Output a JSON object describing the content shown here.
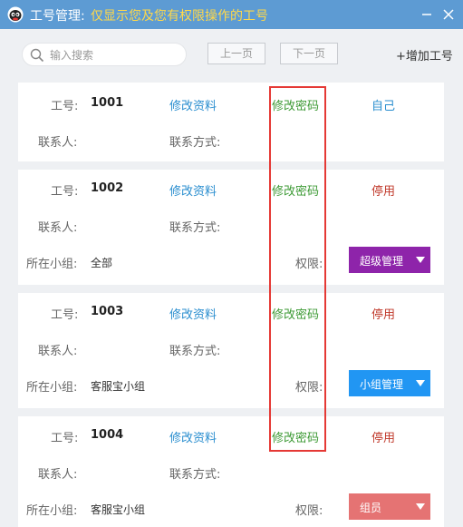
{
  "window": {
    "title": "工号管理:",
    "subtitle": "仅显示您及您有权限操作的工号",
    "minimize_icon": "minimize-icon",
    "close_icon": "close-icon"
  },
  "toolbar": {
    "search_placeholder": "输入搜索",
    "prev_label": "上一页",
    "next_label": "下一页",
    "add_label": "+增加工号"
  },
  "labels": {
    "id": "工号:",
    "contact_person": "联系人:",
    "contact_method": "联系方式:",
    "group": "所在小组:",
    "permission": "权限:",
    "edit_profile": "修改资料",
    "change_password": "修改密码"
  },
  "accounts": [
    {
      "id": "1001",
      "status": "自己",
      "status_color": "#2a8ecf"
    },
    {
      "id": "1002",
      "status": "停用",
      "status_color": "#c0392b",
      "group": "全部",
      "role": "超级管理",
      "role_color": "#8e24aa"
    },
    {
      "id": "1003",
      "status": "停用",
      "status_color": "#c0392b",
      "group": "客服宝小组",
      "role": "小组管理",
      "role_color": "#2196f3"
    },
    {
      "id": "1004",
      "status": "停用",
      "status_color": "#c0392b",
      "group": "客服宝小组",
      "role": "组员",
      "role_color": "#e57373"
    }
  ]
}
